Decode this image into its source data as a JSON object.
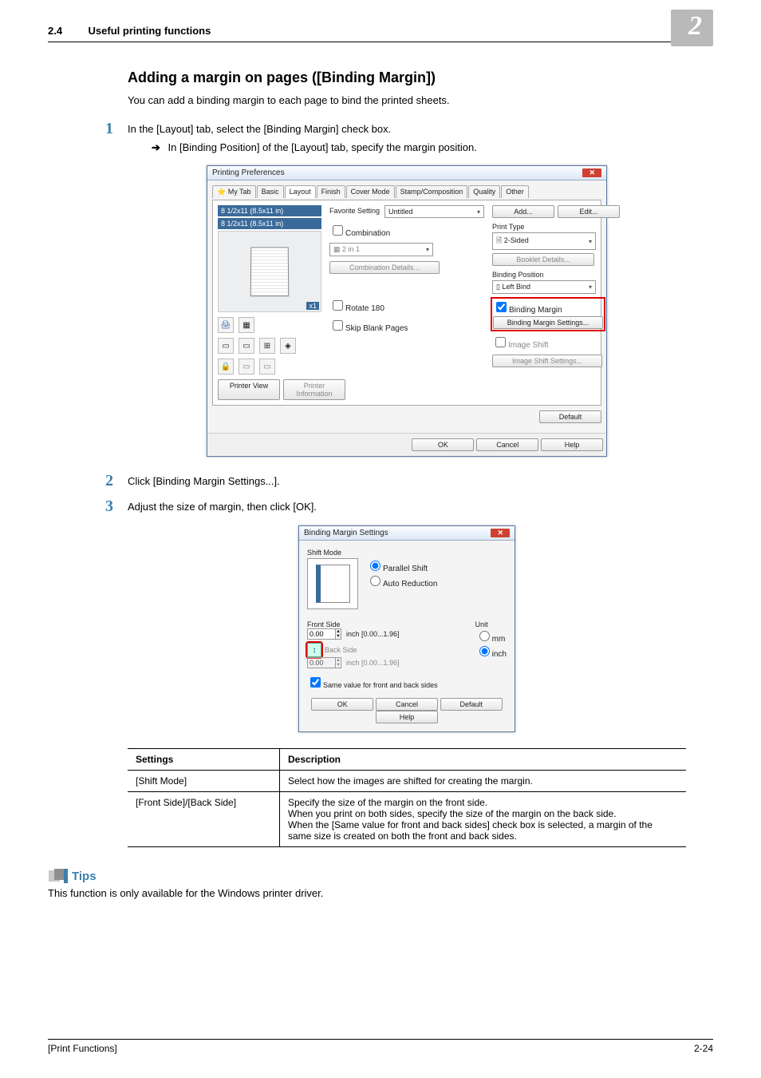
{
  "header": {
    "section_num": "2.4",
    "section_title": "Useful printing functions",
    "chapter": "2"
  },
  "topic_title": "Adding a margin on pages ([Binding Margin])",
  "lead": "You can add a binding margin to each page to bind the printed sheets.",
  "steps": [
    {
      "num": "1",
      "text": "In the [Layout] tab, select the [Binding Margin] check box."
    },
    {
      "num": "2",
      "text": "Click [Binding Margin Settings...]."
    },
    {
      "num": "3",
      "text": "Adjust the size of margin, then click [OK]."
    }
  ],
  "sub_arrow": "In [Binding Position] of the [Layout] tab, specify the margin position.",
  "dialog1": {
    "title": "Printing Preferences",
    "tabs": [
      "My Tab",
      "Basic",
      "Layout",
      "Finish",
      "Cover Mode",
      "Stamp/Composition",
      "Quality",
      "Other"
    ],
    "active_tab": "Layout",
    "paper1": "8 1/2x11 (8.5x11 in)",
    "paper2": "8 1/2x11 (8.5x11 in)",
    "x1": "x1",
    "favorite_label": "Favorite Setting",
    "favorite_value": "Untitled",
    "add_btn": "Add...",
    "edit_btn": "Edit...",
    "combination_label": "Combination",
    "combination_value": "2 in 1",
    "comb_details_btn": "Combination Details...",
    "rotate_label": "Rotate 180",
    "skip_label": "Skip Blank Pages",
    "print_type_label": "Print Type",
    "print_type_value": "2-Sided",
    "booklet_btn": "Booklet Details...",
    "binding_position_label": "Binding Position",
    "binding_position_value": "Left Bind",
    "binding_margin_chk": "Binding Margin",
    "binding_margin_btn": "Binding Margin Settings...",
    "image_shift_chk": "Image Shift",
    "image_shift_btn": "Image Shift Settings...",
    "printer_view_btn": "Printer View",
    "printer_info_btn": "Printer Information",
    "default_btn": "Default",
    "ok_btn": "OK",
    "cancel_btn": "Cancel",
    "help_btn": "Help"
  },
  "dialog2": {
    "title": "Binding Margin Settings",
    "shift_mode_label": "Shift Mode",
    "parallel_shift": "Parallel Shift",
    "auto_reduction": "Auto Reduction",
    "front_side_label": "Front Side",
    "front_value": "0.00",
    "front_range": "inch [0.00...1.96]",
    "back_side_label": "Back Side",
    "back_value": "0.00",
    "back_range": "inch [0.00...1.96]",
    "unit_label": "Unit",
    "unit_mm": "mm",
    "unit_inch": "inch",
    "same_value": "Same value for front and back sides",
    "ok_btn": "OK",
    "cancel_btn": "Cancel",
    "default_btn": "Default",
    "help_btn": "Help"
  },
  "table": {
    "h1": "Settings",
    "h2": "Description",
    "rows": [
      {
        "k": "[Shift Mode]",
        "v": "Select how the images are shifted for creating the margin."
      },
      {
        "k": "[Front Side]/[Back Side]",
        "v": "Specify the size of the margin on the front side.\nWhen you print on both sides, specify the size of the margin on the back side.\nWhen the [Same value for front and back sides] check box is selected, a margin of the same size is created on both the front and back sides."
      }
    ]
  },
  "tips": {
    "label": "Tips",
    "text": "This function is only available for the Windows printer driver."
  },
  "footer": {
    "left": "[Print Functions]",
    "right": "2-24"
  }
}
